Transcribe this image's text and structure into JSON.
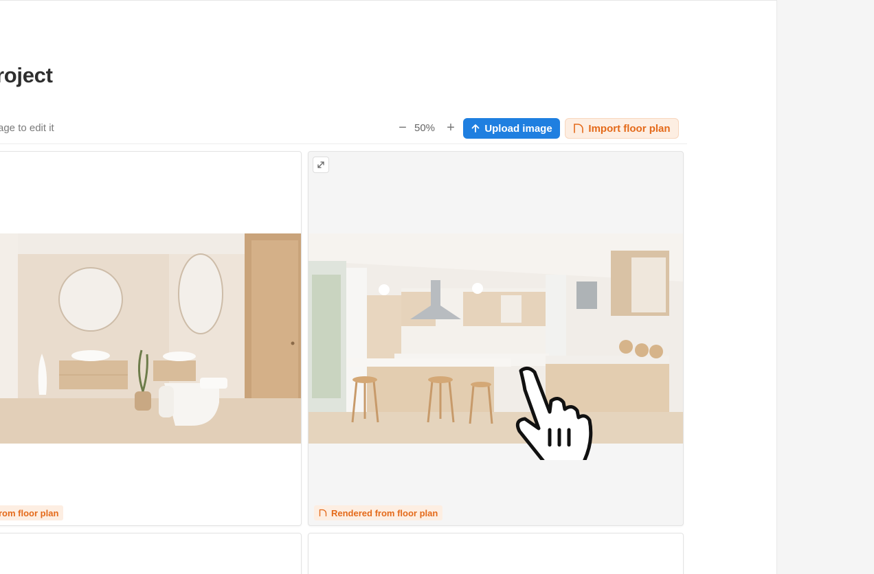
{
  "header": {
    "title": "roject",
    "hint": "age to edit it"
  },
  "toolbar": {
    "zoom_minus": "−",
    "zoom_value": "50%",
    "zoom_plus": "+",
    "upload_label": "Upload image",
    "import_label": "Import floor plan"
  },
  "cards": [
    {
      "badge": "rom floor plan",
      "scene": "bathroom"
    },
    {
      "badge": "Rendered from floor plan",
      "scene": "kitchen"
    }
  ],
  "icons": {
    "upload": "arrow-up-icon",
    "import": "floor-plan-icon",
    "expand": "expand-icon",
    "cursor": "hand-pointer-icon"
  },
  "colors": {
    "primary": "#1f7fe0",
    "accent": "#e46a1a",
    "accent_bg": "#fdeee2"
  }
}
